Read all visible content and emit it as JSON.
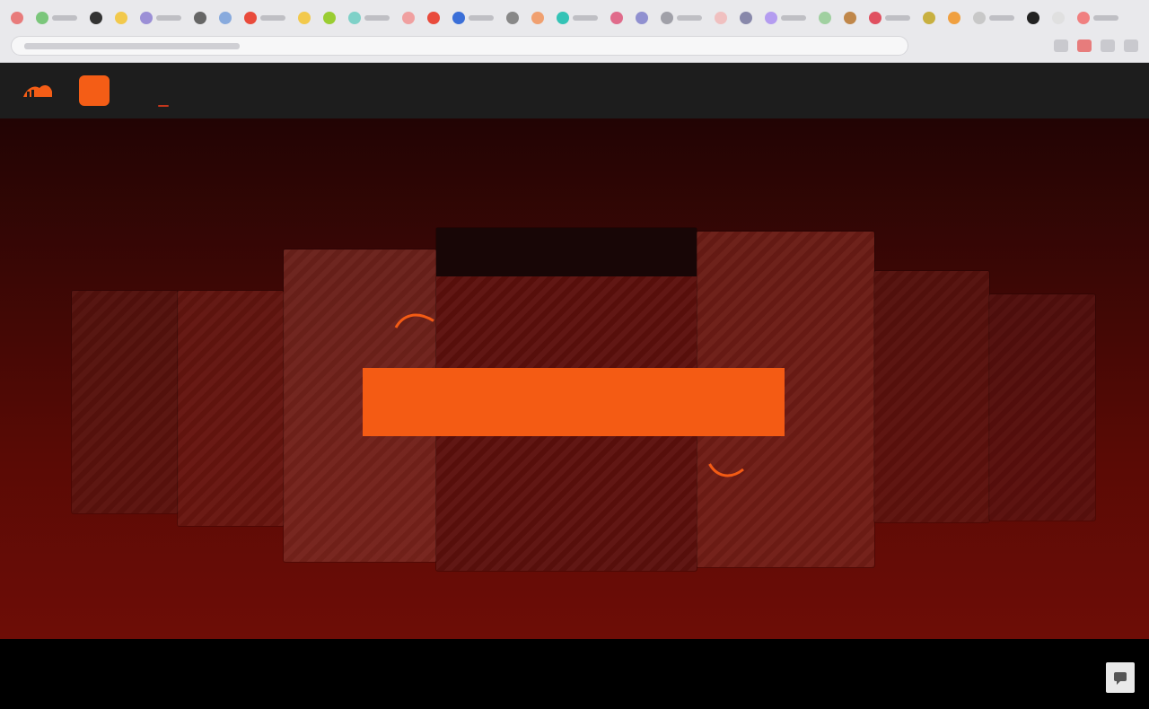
{
  "browser": {
    "bookmark_colors": [
      "#e87b7b",
      "#7bc67b",
      "#333333",
      "#f2c94c",
      "#9b8fd6",
      "#666666",
      "#8ad",
      "#e94b3c",
      "#f2c94c",
      "#9acd32",
      "#7fd1c8",
      "#f0a0a0",
      "#e94b3c",
      "#3b6fd8",
      "#888888",
      "#f0a070",
      "#34c3b6",
      "#e06b8b",
      "#9090d0",
      "#a0a0a8",
      "#f0c0c0",
      "#8888aa",
      "#b49cf0",
      "#a0d0a0",
      "#c0874a",
      "#e05060",
      "#c8b040",
      "#f0a040",
      "#c8c8c8",
      "#222222",
      "#e0e0e0",
      "#f08080"
    ]
  },
  "nav": {
    "brand_name": "",
    "badge_text": "",
    "items": [
      {
        "label": "",
        "sub": ""
      },
      {
        "label": "",
        "pill": ""
      },
      {
        "label": ""
      },
      {
        "label": ""
      },
      {
        "label": ""
      }
    ],
    "right": [
      "",
      ""
    ],
    "lang": ""
  },
  "hero": {
    "cover_title": "",
    "cta_left": "",
    "cta_right": "",
    "caption_line1": "",
    "caption_line2": "",
    "corner_small": "",
    "corner_line1": "",
    "corner_line2": "",
    "mark_left": "",
    "mark_right": "",
    "accent": "#f45b14"
  },
  "footer": {
    "note": "",
    "note_link": "",
    "links": [
      "",
      "",
      "",
      ""
    ]
  }
}
